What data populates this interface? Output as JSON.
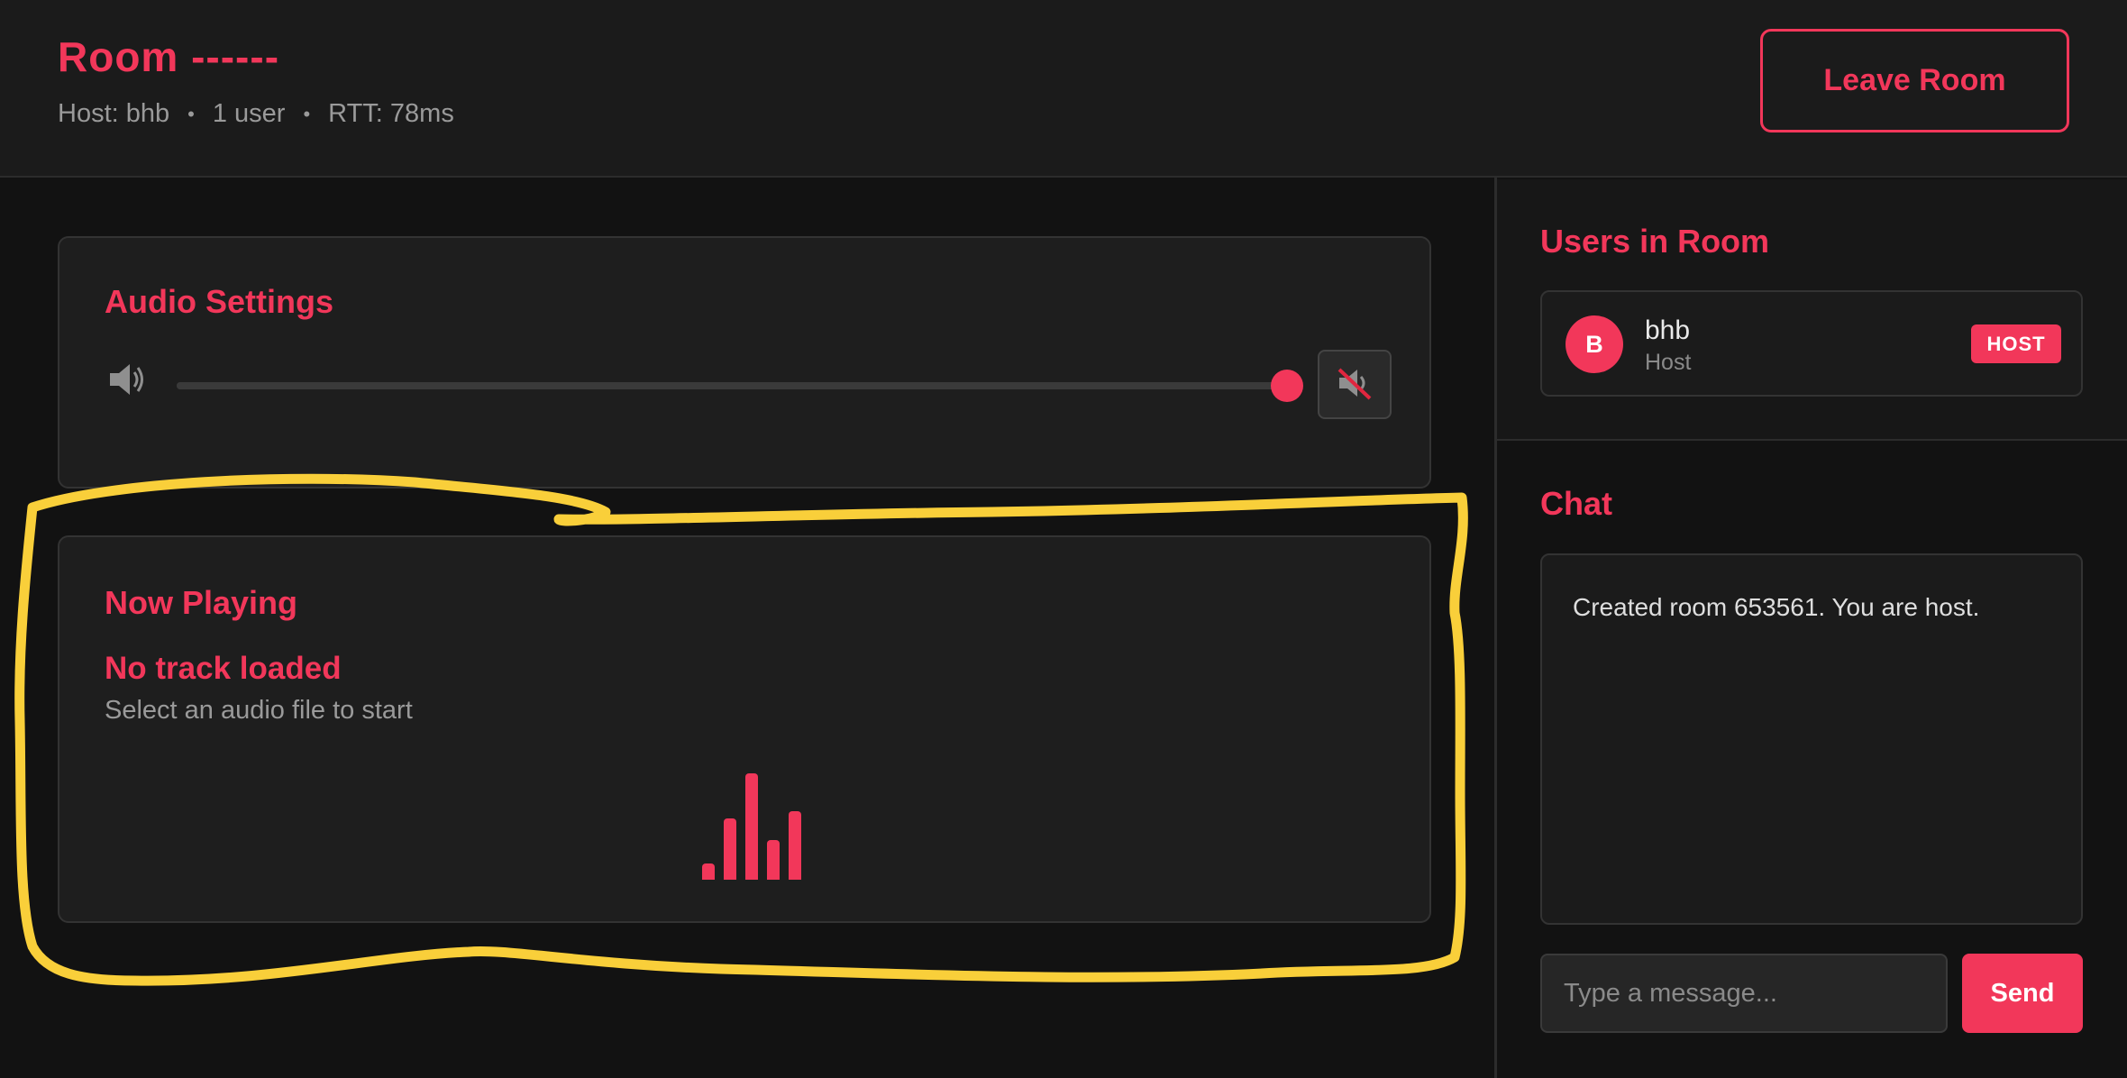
{
  "header": {
    "title": "Room ------",
    "host": "Host: bhb",
    "users": "1 user",
    "rtt": "RTT: 78ms",
    "separator": "•",
    "leave_label": "Leave Room"
  },
  "audio_settings": {
    "title": "Audio Settings",
    "volume": 1.0,
    "volume_icon": "speaker-icon",
    "mute_icon": "speaker-muted-icon"
  },
  "now_playing": {
    "title": "Now Playing",
    "track_title": "No track loaded",
    "track_subtitle": "Select an audio file to start",
    "visualizer_icon": "equalizer-icon"
  },
  "users_panel": {
    "title": "Users in Room",
    "users": [
      {
        "initial": "B",
        "name": "bhb",
        "role": "Host",
        "badge": "HOST"
      }
    ]
  },
  "chat": {
    "title": "Chat",
    "messages": [
      "Created room 653561. You are host."
    ],
    "input_placeholder": "Type a message...",
    "send_label": "Send"
  },
  "colors": {
    "accent": "#f2375a",
    "background": "#121212",
    "card": "#1e1e1e",
    "highlight": "#f9cf3a"
  }
}
